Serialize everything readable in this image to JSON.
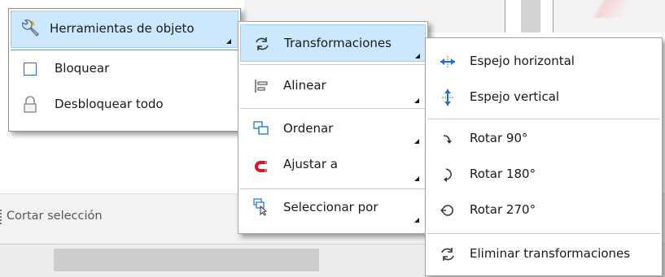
{
  "background": {
    "cut_selection_label": "Cortar selección"
  },
  "menu_level1": {
    "header_label": "Herramientas de objeto",
    "items": [
      {
        "label": "Bloquear",
        "icon": "checkbox-icon"
      },
      {
        "label": "Desbloquear todo",
        "icon": "unlock-icon"
      }
    ]
  },
  "menu_level2": {
    "items": [
      {
        "label": "Transformaciones",
        "icon": "transform-icon",
        "highlighted": true,
        "submenu": true
      },
      {
        "label": "Alinear",
        "icon": "align-icon",
        "submenu": true
      },
      {
        "label": "Ordenar",
        "icon": "order-icon",
        "submenu": true
      },
      {
        "label": "Ajustar a",
        "icon": "magnet-icon",
        "submenu": true
      },
      {
        "label": "Seleccionar por",
        "icon": "select-by-icon",
        "submenu": true
      }
    ]
  },
  "menu_level3": {
    "items": [
      {
        "label": "Espejo horizontal",
        "icon": "mirror-horizontal-icon"
      },
      {
        "label": "Espejo vertical",
        "icon": "mirror-vertical-icon"
      },
      {
        "label": "Rotar 90°",
        "icon": "rotate-90-icon"
      },
      {
        "label": "Rotar 180°",
        "icon": "rotate-180-icon"
      },
      {
        "label": "Rotar 270°",
        "icon": "rotate-270-icon"
      },
      {
        "label": "Eliminar transformaciones",
        "icon": "reset-transform-icon"
      }
    ]
  },
  "colors": {
    "highlight_bg": "#cce8ff",
    "highlight_border": "#99d1ff",
    "magnet_red": "#d71921",
    "mirror_blue": "#1a6fd6"
  }
}
